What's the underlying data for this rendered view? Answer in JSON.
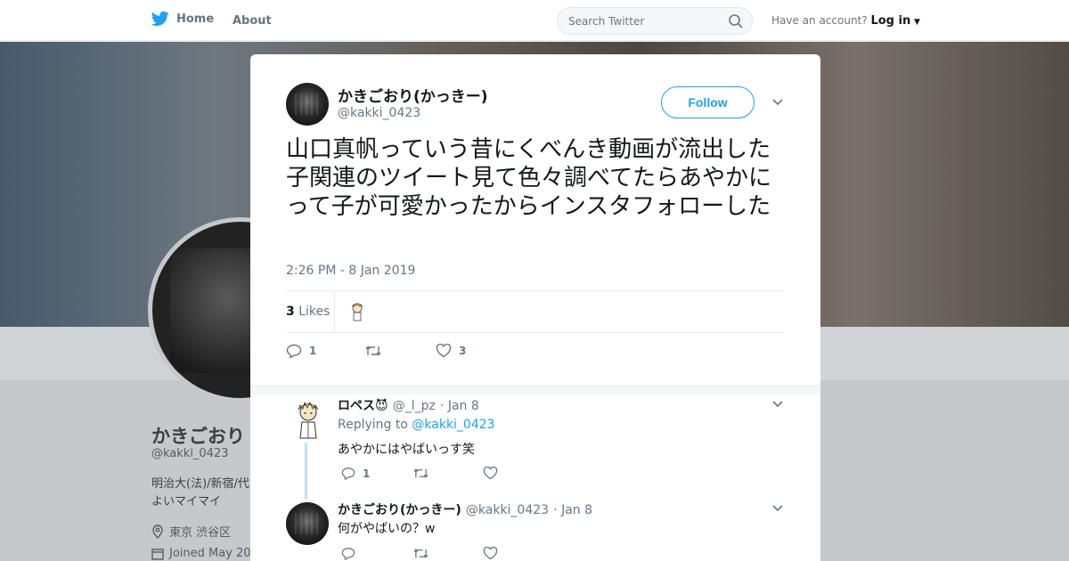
{
  "nav": {
    "home": "Home",
    "about": "About",
    "search_placeholder": "Search Twitter",
    "have_account": "Have an account?",
    "login": "Log in"
  },
  "profile": {
    "name": "かきごおり",
    "handle": "@kakki_0423",
    "bio_line1": "明治大(法)/新宿/代",
    "bio_line2": "よいマイマイ",
    "location": "東京 渋谷区",
    "joined": "Joined May 20"
  },
  "tweet": {
    "name": "かきごおり(かっきー)",
    "handle": "@kakki_0423",
    "follow": "Follow",
    "text": "山口真帆っていう昔にくべんき動画が流出した子関連のツイート見て色々調べてたらあやかにって子が可愛かったからインスタフォローした",
    "time": "2:26 PM - 8 Jan 2019",
    "likes_count": "3",
    "likes_label": "Likes",
    "reply_count": "1",
    "like_count": "3"
  },
  "replies": [
    {
      "name": "ロペス😈",
      "handle": "@_l_pz",
      "date": "· Jan 8",
      "replying_prefix": "Replying to",
      "replying_to": "@kakki_0423",
      "text": "あやかにはやばいっす笑",
      "reply_count": "1"
    },
    {
      "name": "かきごおり(かっきー)",
      "handle": "@kakki_0423",
      "date": "· Jan 8",
      "text": "何がやばいの？w"
    }
  ],
  "colors": {
    "accent": "#1da1f2",
    "muted": "#657786"
  }
}
